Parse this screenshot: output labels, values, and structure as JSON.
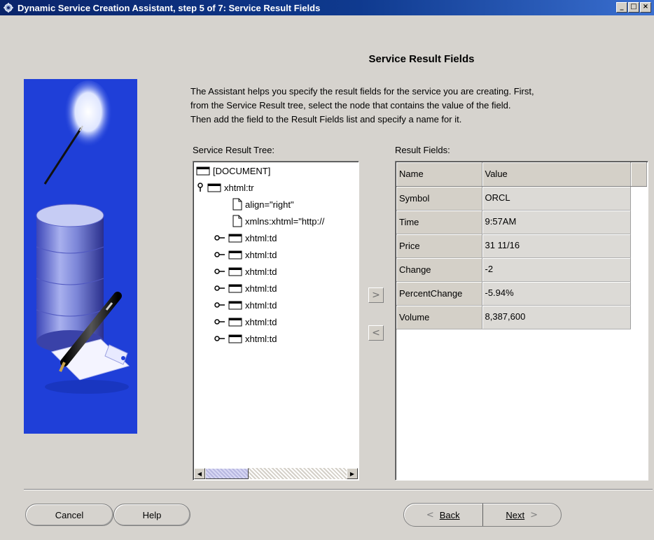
{
  "window": {
    "title": "Dynamic Service Creation Assistant, step 5 of 7: Service Result Fields",
    "controls": [
      "_",
      "□",
      "×"
    ]
  },
  "page": {
    "heading": "Service Result Fields",
    "intro_lines": [
      "The Assistant helps you specify the result fields for the service you are creating. First,",
      "from the Service Result tree, select the node that contains the value of the field.",
      "Then add the field to the Result Fields list and specify a name for it."
    ]
  },
  "tree": {
    "label": "Service Result Tree:",
    "nodes": [
      {
        "text": "[DOCUMENT]",
        "icon": "folder-icon",
        "expander": "none"
      },
      {
        "text": "xhtml:tr",
        "icon": "folder-icon",
        "expander": "expanded-key-icon"
      },
      {
        "text": "align=\"right\"",
        "icon": "document-icon",
        "expander": "none"
      },
      {
        "text": "xmlns:xhtml=\"http://",
        "icon": "document-icon",
        "expander": "none"
      },
      {
        "text": "xhtml:td",
        "icon": "folder-icon",
        "expander": "collapsed-key-icon"
      },
      {
        "text": "xhtml:td",
        "icon": "folder-icon",
        "expander": "collapsed-key-icon"
      },
      {
        "text": "xhtml:td",
        "icon": "folder-icon",
        "expander": "collapsed-key-icon"
      },
      {
        "text": "xhtml:td",
        "icon": "folder-icon",
        "expander": "collapsed-key-icon"
      },
      {
        "text": "xhtml:td",
        "icon": "folder-icon",
        "expander": "collapsed-key-icon"
      },
      {
        "text": "xhtml:td",
        "icon": "folder-icon",
        "expander": "collapsed-key-icon"
      },
      {
        "text": "xhtml:td",
        "icon": "folder-icon",
        "expander": "collapsed-key-icon"
      }
    ]
  },
  "move_buttons": {
    "add": ">",
    "remove": "<"
  },
  "results": {
    "label": "Result Fields:",
    "columns": [
      "Name",
      "Value"
    ],
    "rows": [
      {
        "name": "Symbol",
        "value": "ORCL"
      },
      {
        "name": "Time",
        "value": "9:57AM"
      },
      {
        "name": "Price",
        "value": "31 11/16"
      },
      {
        "name": "Change",
        "value": "-2"
      },
      {
        "name": "PercentChange",
        "value": "-5.94%"
      },
      {
        "name": "Volume",
        "value": "8,387,600"
      }
    ]
  },
  "footer": {
    "cancel": "Cancel",
    "help": "Help",
    "back": "Back",
    "next": "Next",
    "back_arrow": "<",
    "next_arrow": ">"
  },
  "colors": {
    "titlebar": "#0a246a",
    "art_panel": "#1f3fd8",
    "dialog_bg": "#d6d3ce"
  }
}
